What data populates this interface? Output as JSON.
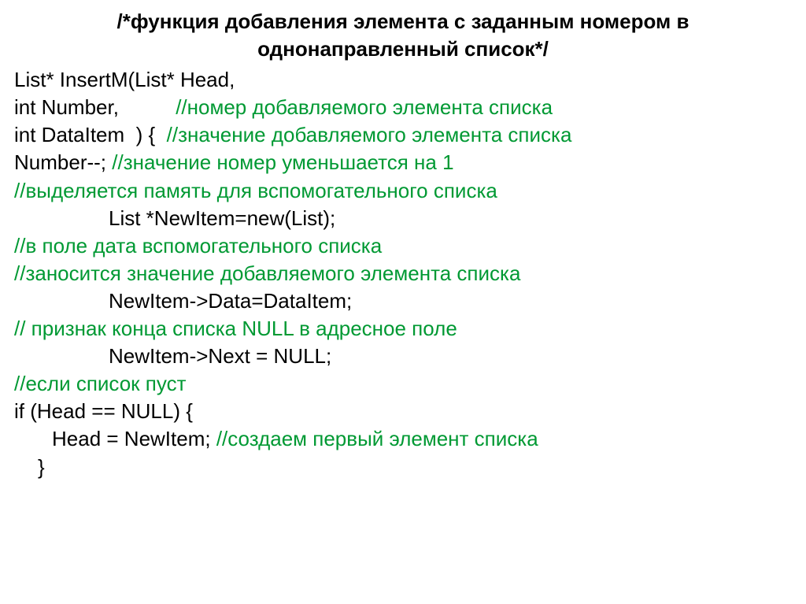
{
  "header": {
    "line1": "/*функция добавления элемента с заданным номером в",
    "line2": "однонаправленный список*/"
  },
  "lines": {
    "l1_code": "List* InsertM(List* Head,",
    "l2_code": "int Number,          ",
    "l2_comment": "//номер добавляемого элемента списка",
    "l3_code": "int DataItem  ) {  ",
    "l3_comment": "//значение добавляемого элемента списка",
    "l4_code": "Number--; ",
    "l4_comment": "//значение номер уменьшается на 1",
    "l5_comment": "//выделяется память для вспомогательного списка",
    "l6_code": "List *NewItem=new(List);",
    "l7_comment": "//в поле дата вспомогательного списка",
    "l8_comment": "//заносится значение добавляемого элемента списка",
    "l9_code": "NewItem->Data=DataItem;",
    "l10_comment": "// признак конца списка NULL в адресное поле",
    "l11_code": "NewItem->Next = NULL;",
    "l12_comment": "//если список пуст",
    "l13_code": "if (Head == NULL) {",
    "l14_code": "Head = NewItem; ",
    "l14_comment": "//создаем первый элемент списка",
    "l15_code": "}"
  }
}
